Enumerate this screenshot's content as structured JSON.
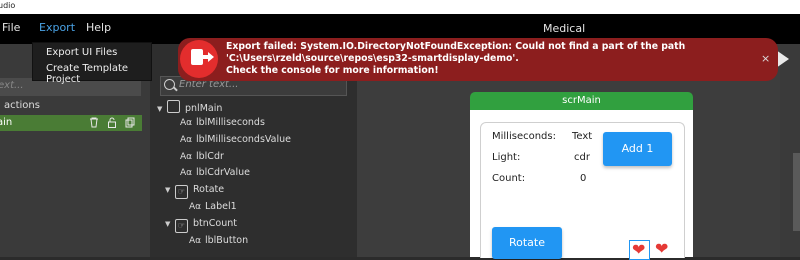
{
  "titlebar": {
    "text": "udio"
  },
  "menu": {
    "file": "File",
    "export": "Export",
    "help": "Help"
  },
  "window_title": "Medical",
  "export_menu": {
    "items": [
      "Export UI Files",
      "Create Template Project"
    ]
  },
  "left_panel": {
    "search_placeholder": "ext...",
    "actions_label": "l actions",
    "screen_row": "ain"
  },
  "hierarchy": {
    "search_placeholder": "Enter text...",
    "items": [
      {
        "label": "pnlMain"
      },
      {
        "label": "lblMilliseconds"
      },
      {
        "label": "lblMillisecondsValue"
      },
      {
        "label": "lblCdr"
      },
      {
        "label": "lblCdrValue"
      },
      {
        "label": "Rotate"
      },
      {
        "label": "Label1"
      },
      {
        "label": "btnCount"
      },
      {
        "label": "lblButton"
      }
    ]
  },
  "screen": {
    "name": "scrMain",
    "labels": {
      "milliseconds": "Milliseconds:",
      "milliseconds_value": "Text",
      "light": "Light:",
      "light_value": "cdr",
      "count": "Count:",
      "count_value": "0"
    },
    "buttons": {
      "add": "Add 1",
      "rotate": "Rotate"
    },
    "accent": "#2196f3",
    "header_color": "#31a03f"
  },
  "toast": {
    "line1": "Export failed: System.IO.DirectoryNotFoundException: Could not find a part of the path",
    "line2": "'C:\\Users\\rzeld\\source\\repos\\esp32-smartdisplay-demo'.",
    "line3": "Check the console for more information!",
    "close": "×",
    "color": "#8c1e1e"
  }
}
